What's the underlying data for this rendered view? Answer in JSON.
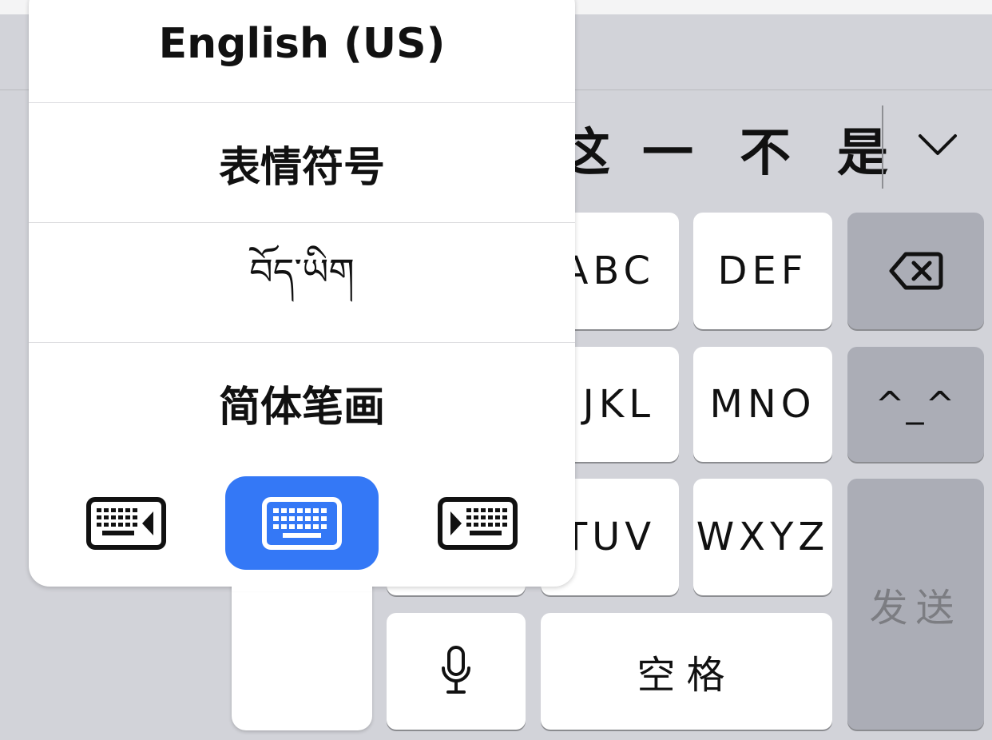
{
  "candidates": [
    "这",
    "一",
    "不",
    "是"
  ],
  "candidate_expand_icon": "chevron-down-icon",
  "language_menu": {
    "items": [
      {
        "label": "English (US)"
      },
      {
        "label": "表情符号"
      },
      {
        "label": "བོད་ཡིག"
      },
      {
        "label": "简体笔画"
      }
    ],
    "modes": [
      {
        "name": "keyboard-left-icon",
        "selected": false
      },
      {
        "name": "keyboard-full-icon",
        "selected": true
      },
      {
        "name": "keyboard-right-icon",
        "selected": false
      }
    ],
    "selected_color": "#3478f6"
  },
  "keyboard": {
    "rows": [
      [
        "ABC",
        "DEF"
      ],
      [
        "JKL",
        "MNO"
      ],
      [
        "TUV",
        "WXYZ"
      ]
    ],
    "emoticon_key": "^_^",
    "send_key": "发送",
    "space_key": "空格",
    "mic_icon": "microphone-icon",
    "delete_icon": "delete-icon"
  }
}
